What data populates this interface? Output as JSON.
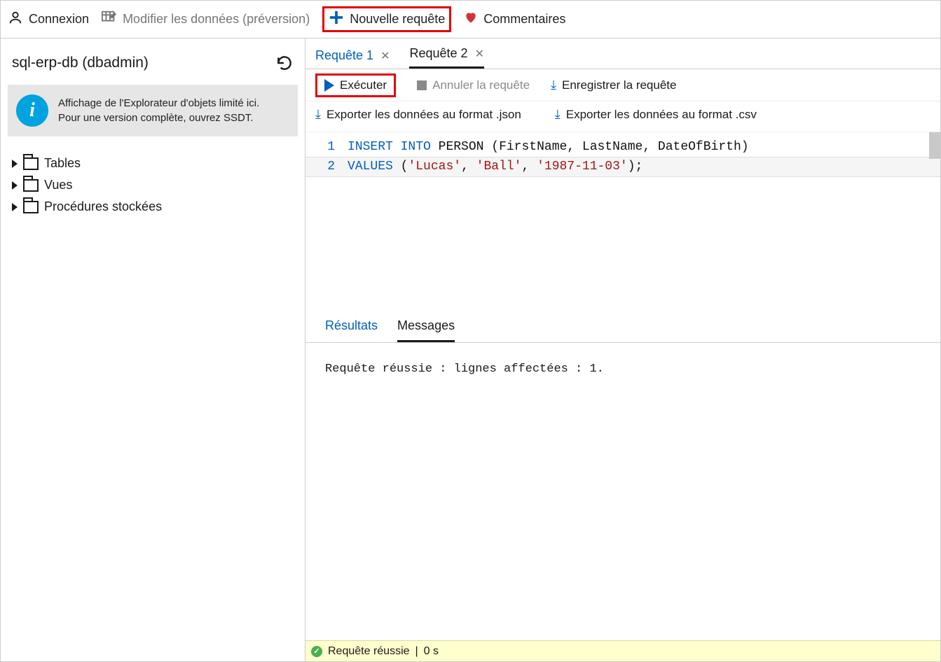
{
  "toolbar": {
    "login": "Connexion",
    "edit_data": "Modifier les données (préversion)",
    "new_query": "Nouvelle requête",
    "comments": "Commentaires"
  },
  "sidebar": {
    "title": "sql-erp-db (dbadmin)",
    "info_line1": "Affichage de l'Explorateur d'objets limité ici.",
    "info_line2": "Pour une version complète, ouvrez SSDT.",
    "tree": {
      "tables": "Tables",
      "views": "Vues",
      "sprocs": "Procédures stockées"
    }
  },
  "tabs": {
    "q1": "Requête 1",
    "q2": "Requête 2"
  },
  "actions": {
    "execute": "Exécuter",
    "cancel": "Annuler la requête",
    "save": "Enregistrer la requête",
    "export_json": "Exporter les données au format .json",
    "export_csv": "Exporter les données au format .csv"
  },
  "editor": {
    "line1_num": "1",
    "line2_num": "2",
    "kw_insert": "INSERT",
    "kw_into": "INTO",
    "ident_person": "PERSON",
    "cols": "(FirstName, LastName, DateOfBirth)",
    "kw_values": "VALUES",
    "paren_open": "(",
    "str1": "'Lucas'",
    "comma1": ", ",
    "str2": "'Ball'",
    "comma2": ", ",
    "str3": "'1987-11-03'",
    "paren_close_semi": ");"
  },
  "results": {
    "tab_results": "Résultats",
    "tab_messages": "Messages",
    "message": "Requête réussie : lignes affectées : 1."
  },
  "status": {
    "text": "Requête réussie",
    "divider": "|",
    "timing": "0 s"
  }
}
